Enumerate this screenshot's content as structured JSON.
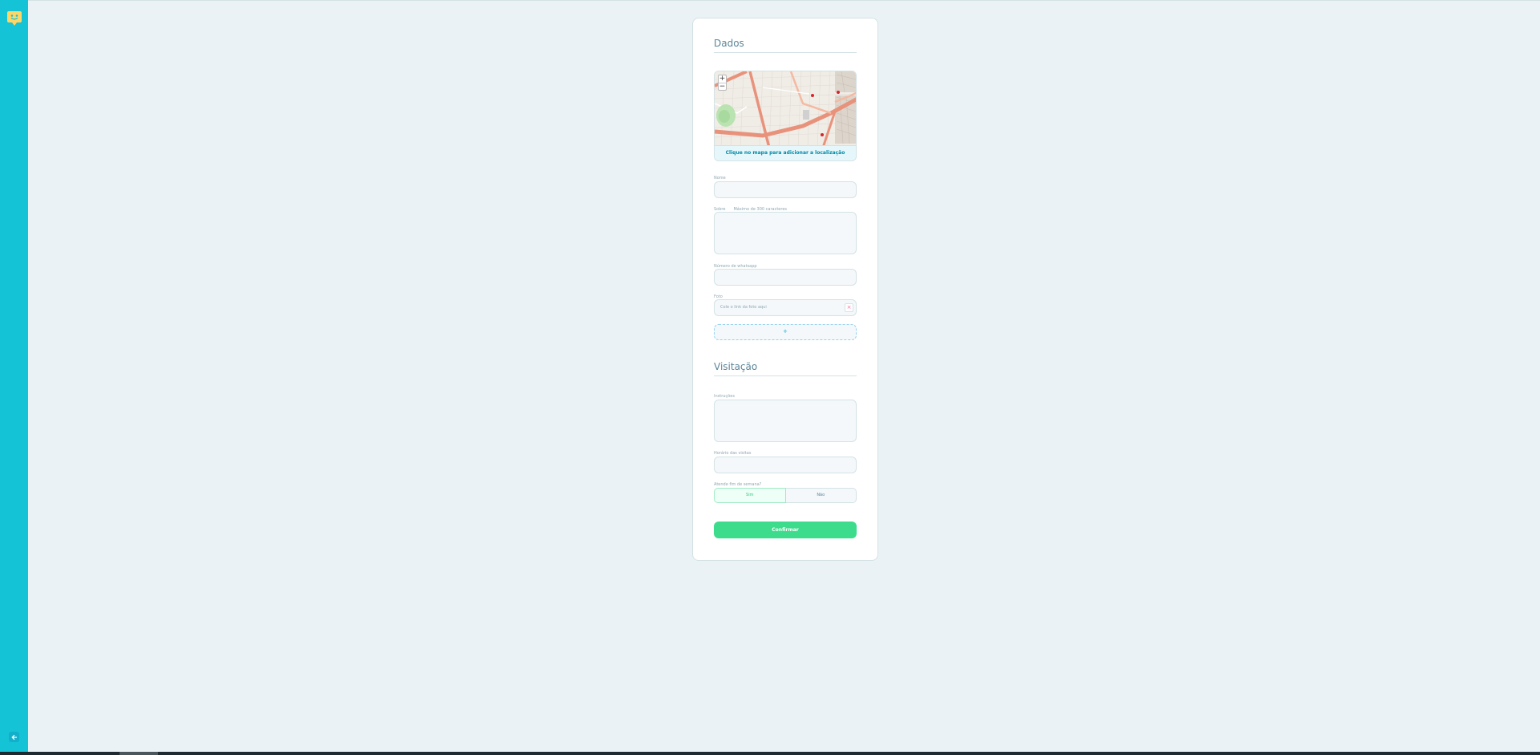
{
  "sidebar": {
    "logo_icon": "happy-face-map-pin-icon",
    "back_icon": "arrow-left-icon",
    "accent": "#15c3d6"
  },
  "form": {
    "section_data": {
      "title": "Dados"
    },
    "map": {
      "zoom_in": "+",
      "zoom_out": "−",
      "hint": "Clique no mapa para adicionar a localização"
    },
    "name": {
      "label": "Nome",
      "value": ""
    },
    "about": {
      "label": "Sobre",
      "hint": "Máximo de 300 caracteres",
      "value": ""
    },
    "whatsapp": {
      "label": "Número de whatsapp",
      "value": ""
    },
    "photos": {
      "label": "Foto",
      "placeholder": "Cole o link da foto aqui",
      "remove_symbol": "×",
      "add_symbol": "+"
    },
    "section_visit": {
      "title": "Visitação"
    },
    "instructions": {
      "label": "Instruções",
      "value": ""
    },
    "hours": {
      "label": "Horário das visitas",
      "value": ""
    },
    "weekends": {
      "label": "Atende fim de semana?",
      "yes": "Sim",
      "no": "Não",
      "selected": "Sim"
    },
    "confirm": "Confirmar"
  }
}
